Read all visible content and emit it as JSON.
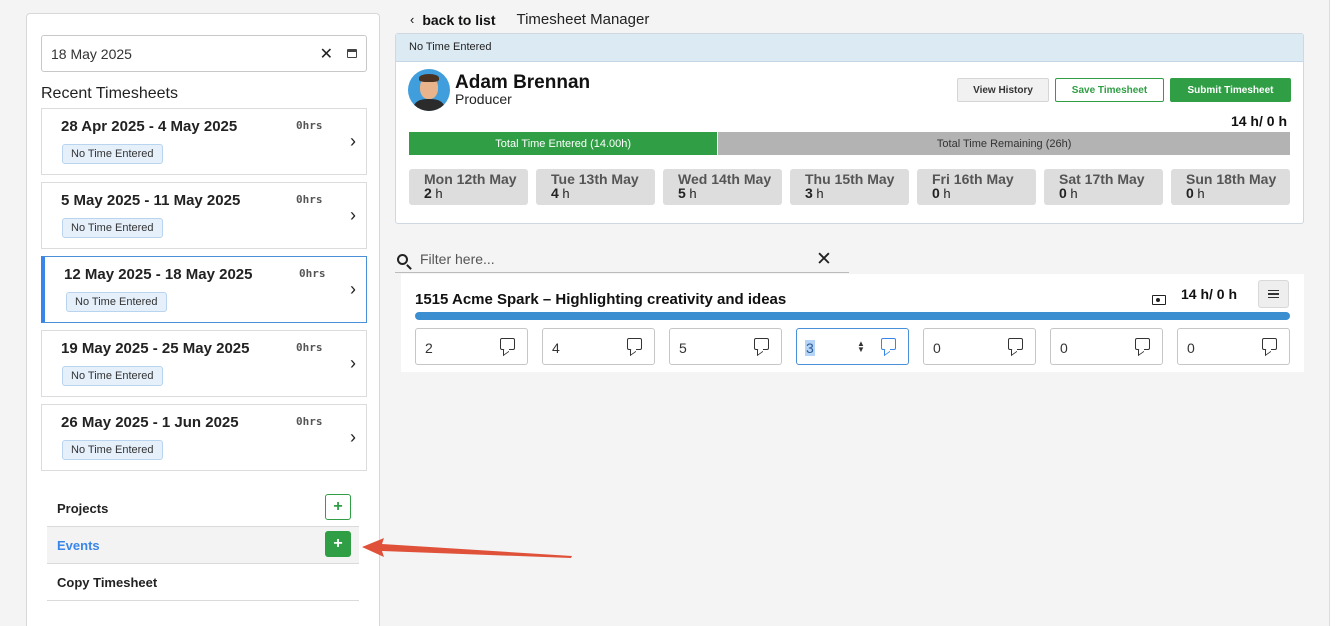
{
  "sidebar": {
    "date_value": "18 May 2025",
    "recent_title": "Recent Timesheets",
    "timesheets": [
      {
        "range": "28 Apr 2025 - 4 May 2025",
        "hours": "0hrs",
        "status": "No Time Entered"
      },
      {
        "range": "5 May 2025 - 11 May 2025",
        "hours": "0hrs",
        "status": "No Time Entered"
      },
      {
        "range": "12 May 2025 - 18 May 2025",
        "hours": "0hrs",
        "status": "No Time Entered"
      },
      {
        "range": "19 May 2025 - 25 May 2025",
        "hours": "0hrs",
        "status": "No Time Entered"
      },
      {
        "range": "26 May 2025 - 1 Jun 2025",
        "hours": "0hrs",
        "status": "No Time Entered"
      }
    ],
    "menu": {
      "projects": "Projects",
      "events": "Events",
      "copy": "Copy Timesheet",
      "plus": "+"
    }
  },
  "header": {
    "back_label": "back to list",
    "back_icon": "‹",
    "title": "Timesheet Manager"
  },
  "timesheet": {
    "status": "No Time Entered",
    "person_name": "Adam Brennan",
    "person_role": "Producer",
    "buttons": {
      "history": "View History",
      "save": "Save Timesheet",
      "submit": "Submit Timesheet"
    },
    "total_hours": "14 h/ 0 h",
    "progress_fraction": 0.35,
    "entered_label": "Total Time Entered (14.00h)",
    "remaining_label": "Total Time Remaining (26h)",
    "days": [
      {
        "name": "Mon 12th May",
        "value": "2",
        "unit": "h"
      },
      {
        "name": "Tue 13th May",
        "value": "4",
        "unit": "h"
      },
      {
        "name": "Wed 14th May",
        "value": "5",
        "unit": "h"
      },
      {
        "name": "Thu 15th May",
        "value": "3",
        "unit": "h"
      },
      {
        "name": "Fri 16th May",
        "value": "0",
        "unit": "h"
      },
      {
        "name": "Sat 17th May",
        "value": "0",
        "unit": "h"
      },
      {
        "name": "Sun 18th May",
        "value": "0",
        "unit": "h"
      }
    ]
  },
  "filter": {
    "placeholder": "Filter here...",
    "clear": "✕"
  },
  "project": {
    "title": "1515 Acme Spark – Highlighting creativity and ideas",
    "hours": "14 h/ 0 h",
    "entries": [
      "2",
      "4",
      "5",
      "3",
      "0",
      "0",
      "0"
    ]
  },
  "colors": {
    "accent_green": "#2f9e44",
    "accent_blue": "#3a86e8",
    "annotation_arrow": "#e0513a"
  }
}
